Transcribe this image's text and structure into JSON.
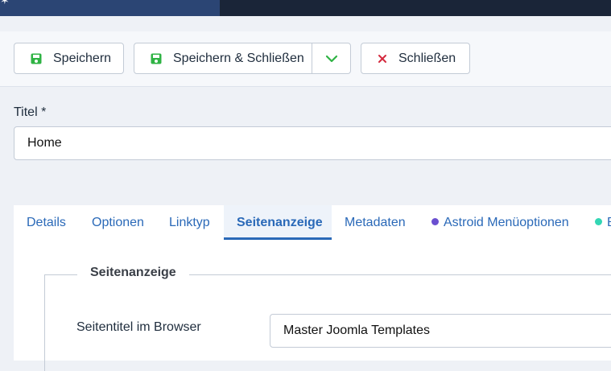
{
  "toolbar": {
    "save_label": "Speichern",
    "save_close_label": "Speichern & Schließen",
    "close_label": "Schließen"
  },
  "title_field": {
    "label": "Titel *",
    "value": "Home"
  },
  "tabs": [
    {
      "label": "Details"
    },
    {
      "label": "Optionen"
    },
    {
      "label": "Linktyp"
    },
    {
      "label": "Seitenanzeige"
    },
    {
      "label": "Metadaten"
    },
    {
      "label": "Astroid Menüoptionen",
      "dot_color": "#6a4fd0"
    },
    {
      "label": "B",
      "dot_color": "#33d6b4"
    }
  ],
  "active_tab": "Seitenanzeige",
  "panel": {
    "legend": "Seitenanzeige",
    "browser_title_label": "Seitentitel im Browser",
    "browser_title_value": "Master Joomla Templates"
  },
  "colors": {
    "accent": "#2a69b8",
    "save_icon": "#2fb344",
    "close_icon": "#d4293d",
    "header": "#1a2538"
  }
}
